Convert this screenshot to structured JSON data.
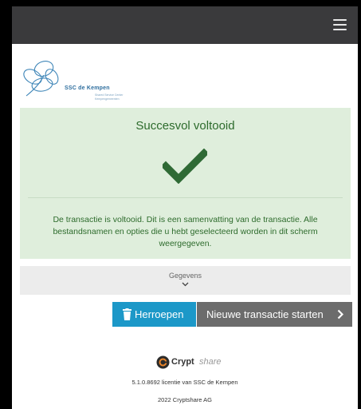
{
  "header": {
    "menu_icon": "hamburger-menu-icon"
  },
  "logo": {
    "name": "SSC de Kempen",
    "subtitle_line1": "Shared Service Center",
    "subtitle_line2": "Kempengemeenten",
    "icon": "flower-logo-icon"
  },
  "status": {
    "title": "Succesvol voltooid",
    "icon": "checkmark-icon",
    "message": "De transactie is voltooid. Dit is een samenvatting van de transactie. Alle bestandsnamen en opties die u hebt geselecteerd worden in dit scherm weergegeven."
  },
  "details": {
    "label": "Gegevens",
    "icon": "chevron-down-icon"
  },
  "actions": {
    "revoke_label": "Herroepen",
    "revoke_icon": "trash-icon",
    "new_transaction_label": "Nieuwe transactie starten",
    "new_transaction_icon": "chevron-right-icon"
  },
  "footer": {
    "brand_bold": "Crypt",
    "brand_light": "share",
    "license": "5.1.0.8692 licentie van SSC de Kempen",
    "copyright": "2022 Cryptshare AG"
  },
  "colors": {
    "topbar": "#3a3a3c",
    "success_bg": "#dfeedc",
    "success_text": "#2d6b2c",
    "revoke_button": "#1c98c8",
    "new_button": "#6c6c6c"
  }
}
